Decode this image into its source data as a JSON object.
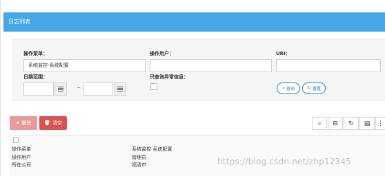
{
  "panel": {
    "title": "日志列表"
  },
  "search": {
    "menu_label": "操作菜单：",
    "menu_value": "系统监控-系统配置",
    "user_label": "操作用户：",
    "user_value": "",
    "uri_label": "URI：",
    "uri_value": "",
    "date_label": "日期范围：",
    "date_from": "",
    "date_to": "",
    "range_sep": "~",
    "only_errors_label": "只查询异常信息：",
    "query_label": "查询",
    "reset_label": "重置"
  },
  "toolbar": {
    "delete_label": "删除",
    "clear_label": "清空"
  },
  "table": {
    "rows": [
      {
        "key": "操作菜单",
        "value": "系统监控-系统配置"
      },
      {
        "key": "操作用户",
        "value": "管理员"
      },
      {
        "key": "所在公司",
        "value": "福清市"
      }
    ]
  },
  "watermark": "https://blog.csdn.net/zhp12345"
}
